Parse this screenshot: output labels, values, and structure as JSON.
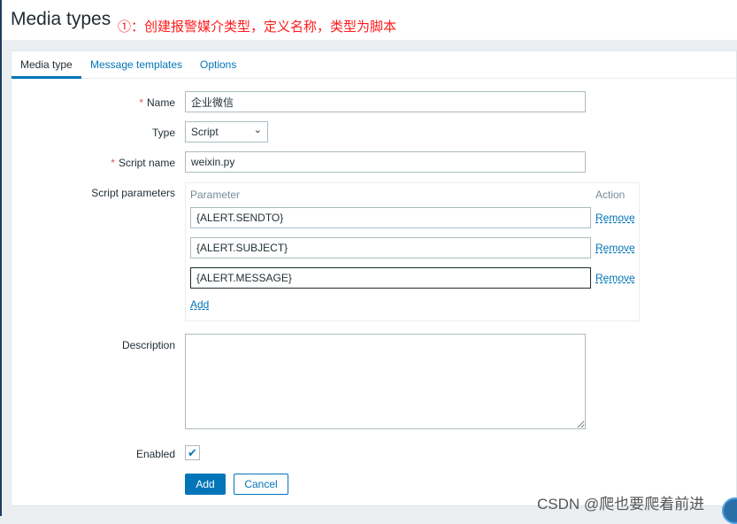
{
  "header": {
    "title": "Media types",
    "annotation": "①：创建报警媒介类型，定义名称，类型为脚本"
  },
  "tabs": [
    {
      "label": "Media type"
    },
    {
      "label": "Message templates"
    },
    {
      "label": "Options"
    }
  ],
  "form": {
    "name": {
      "label": "Name",
      "value": "企业微信"
    },
    "type": {
      "label": "Type",
      "value": "Script"
    },
    "script_name": {
      "label": "Script name",
      "value": "weixin.py"
    },
    "script_parameters": {
      "label": "Script parameters",
      "col_parameter": "Parameter",
      "col_action": "Action",
      "rows": [
        {
          "value": "{ALERT.SENDTO}",
          "action": "Remove"
        },
        {
          "value": "{ALERT.SUBJECT}",
          "action": "Remove"
        },
        {
          "value": "{ALERT.MESSAGE}",
          "action": "Remove"
        }
      ],
      "add_label": "Add"
    },
    "description": {
      "label": "Description",
      "value": ""
    },
    "enabled": {
      "label": "Enabled",
      "checked": true
    }
  },
  "buttons": {
    "add": "Add",
    "cancel": "Cancel"
  },
  "watermark": "CSDN @爬也要爬着前进",
  "colors": {
    "accent": "#0275b8",
    "annotation": "#ff1a1a",
    "required": "#e45959"
  }
}
